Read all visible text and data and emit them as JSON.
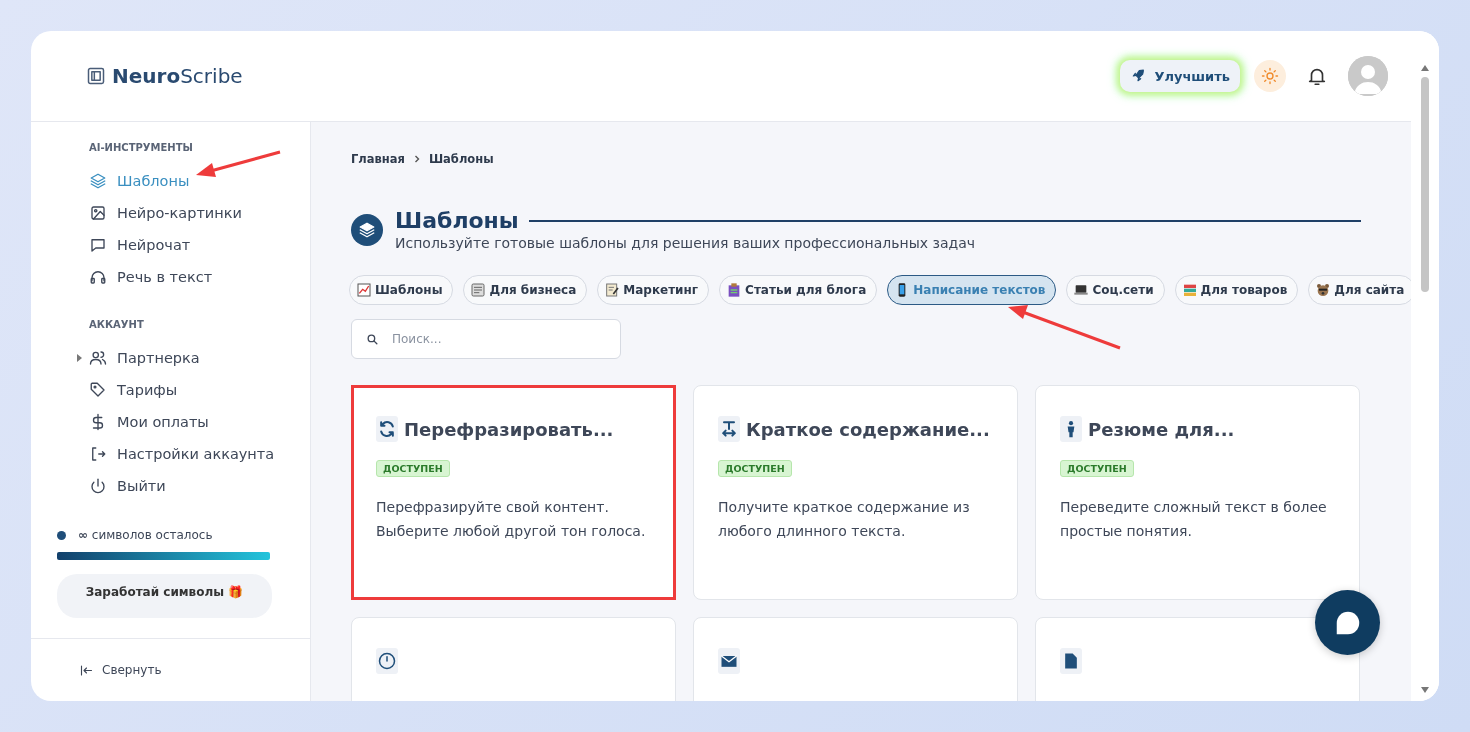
{
  "brand": {
    "name_bold": "Neuro",
    "name_light": "Scribe"
  },
  "header": {
    "upgrade_button": "Улучшить"
  },
  "sidebar": {
    "sections": [
      {
        "title": "AI-ИНСТРУМЕНТЫ",
        "items": [
          {
            "label": "Шаблоны",
            "selected": true
          },
          {
            "label": "Нейро-картинки",
            "selected": false
          },
          {
            "label": "Нейрочат",
            "selected": false
          },
          {
            "label": "Речь в текст",
            "selected": false
          }
        ]
      },
      {
        "title": "АККАУНТ",
        "items": [
          {
            "label": "Партнерка",
            "selected": false,
            "expanded": false
          },
          {
            "label": "Тарифы",
            "selected": false
          },
          {
            "label": "Мои оплаты",
            "selected": false
          },
          {
            "label": "Настройки аккаунта",
            "selected": false
          },
          {
            "label": "Выйти",
            "selected": false
          }
        ]
      }
    ],
    "credits": {
      "text": "**∞** символов осталось",
      "level": 1
    },
    "earn_button": "Заработай символы 🎁",
    "collapse": "Свернуть"
  },
  "breadcrumb": [
    "Главная",
    "Шаблоны"
  ],
  "page": {
    "title": "Шаблоны",
    "subtitle": "Используйте готовые шаблоны для решения ваших профессиональных задач"
  },
  "chips": [
    {
      "label": "Шаблоны",
      "selected": false
    },
    {
      "label": "Для бизнеса",
      "selected": false
    },
    {
      "label": "Маркетинг",
      "selected": false
    },
    {
      "label": "Статьи для блога",
      "selected": false
    },
    {
      "label": "Написание текстов",
      "selected": true
    },
    {
      "label": "Соц.сети",
      "selected": false
    },
    {
      "label": "Для товаров",
      "selected": false
    },
    {
      "label": "Для сайта",
      "selected": false
    }
  ],
  "search": {
    "placeholder": "Поиск..."
  },
  "cards": [
    {
      "title": "Перефразировать...",
      "badge": "ДОСТУПЕН",
      "description": "Перефразируйте свой контент. Выберите любой другой тон голоса.",
      "highlighted": true
    },
    {
      "title": "Краткое содержание...",
      "badge": "ДОСТУПЕН",
      "description": "Получите краткое содержание из любого длинного текста.",
      "highlighted": false
    },
    {
      "title": "Резюме для...",
      "badge": "ДОСТУПЕН",
      "description": "Переведите сложный текст в более простые понятия.",
      "highlighted": false
    },
    {
      "highlighted": false
    },
    {
      "highlighted": false
    },
    {
      "highlighted": false
    }
  ]
}
